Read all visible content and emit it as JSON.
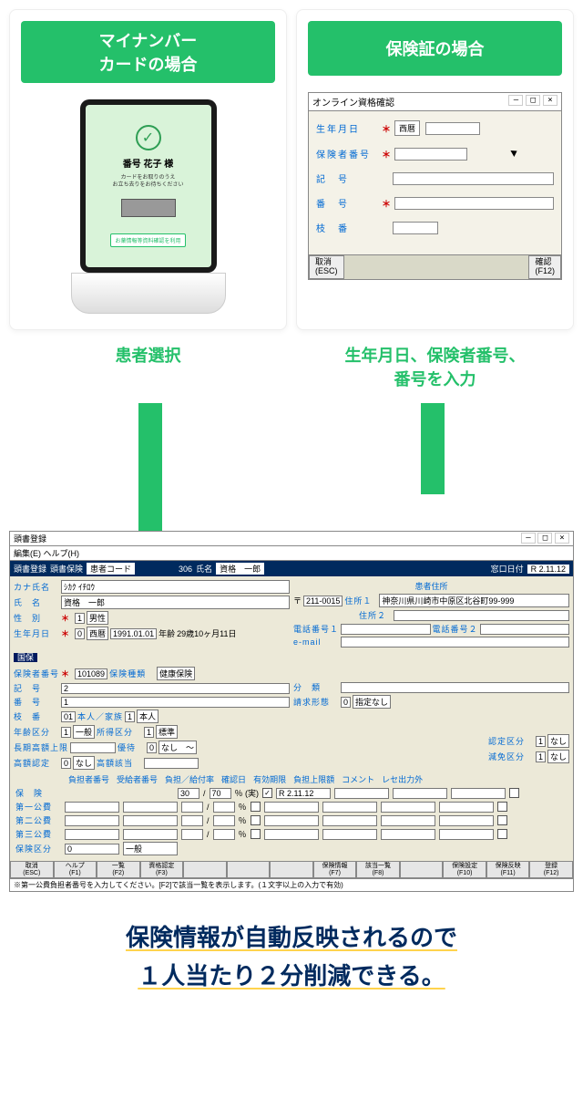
{
  "cards": {
    "left_title": "マイナンバー\nカードの場合",
    "right_title": "保険証の場合"
  },
  "kiosk": {
    "name": "番号 花子 様",
    "hint": "カードをお取りのうえ\nお立ち去りをお待ちください",
    "button": "お薬情報等資料確認を利用"
  },
  "dlg": {
    "title": "オンライン資格確認",
    "rows": {
      "birth": "生年月日",
      "birth_combo": "西暦",
      "insurer": "保険者番号",
      "symbol": "記　号",
      "number": "番　号",
      "branch": "枝　番"
    },
    "foot": {
      "cancel": "取消\n(ESC)",
      "ok": "確認\n(F12)"
    }
  },
  "captions": {
    "left": "患者選択",
    "right": "生年月日、保険者番号、\n番号を入力"
  },
  "reg": {
    "wintitle": "頭書登録",
    "menu": "編集(E) ヘルプ(H)",
    "top": {
      "header1": "頭書登録",
      "header2": "頭書保険",
      "pcode_lab": "患者コード",
      "code": "306",
      "name_lab": "氏名",
      "name_val": "資格　一郎",
      "date_lab": "窓口日付",
      "date_val": "R 2.11.12"
    },
    "left": {
      "kana_lab": "カナ氏名",
      "kana_val": "ｼｶｸ ｲﾁﾛｳ",
      "name_lab": "氏　名",
      "name_val": "資格　一郎",
      "sex_lab": "性　別",
      "sex_code": "1",
      "sex_val": "男性",
      "birth_lab": "生年月日",
      "birth_code": "0",
      "birth_era": "西暦",
      "birth_val": "1991.01.01",
      "age_lab": "年齢",
      "age_val": "29歳10ヶ月11日"
    },
    "right": {
      "addr_h": "患者住所",
      "zip": "211-0015",
      "addr1_lab": "住所１",
      "addr1": "神奈川県川崎市中原区北谷町99-999",
      "addr2_lab": "住所２",
      "tel1_lab": "電話番号１",
      "tel2_lab": "電話番号２",
      "email_lab": "e-mail"
    },
    "ins": {
      "tag": "国保",
      "insurer_lab": "保険者番号",
      "insurer": "101089",
      "kind_lab": "保険種類",
      "kind": "健康保険",
      "symbol_lab": "記　号",
      "symbol": "2",
      "number_lab": "番　号",
      "number": "1",
      "branch_lab": "枝　番",
      "branch": "01",
      "rel_lab": "本人／家族",
      "rel_code": "1",
      "rel": "本人",
      "agecls_lab": "年齢区分",
      "agecls_code": "1",
      "agecls": "一般",
      "inccls_lab": "所得区分",
      "inccls_code": "1",
      "inccls": "標準",
      "cap_lab": "長期高額上限",
      "merit_lab": "優待",
      "merit_code": "0",
      "merit_val": "なし　〜",
      "highamt_lab": "高額認定",
      "highamt_code": "0",
      "highamt_val": "なし",
      "highamt2_lab": "高額該当",
      "class_lab": "分　類",
      "billing_lab": "請求形態",
      "billing_code": "0",
      "billing_val": "指定なし",
      "rec_lab": "認定区分",
      "rec_code": "1",
      "rec_val": "なし",
      "red_lab": "減免区分",
      "red_code": "1",
      "red_val": "なし"
    },
    "hdr": [
      "負担者番号",
      "受給者番号",
      "負担／給付率",
      "確認日",
      "有効期限",
      "負担上限額",
      "コメント",
      "レセ出力外"
    ],
    "rows_lab": [
      "保　険",
      "第一公費",
      "第二公費",
      "第三公費",
      "保険区分"
    ],
    "r0": {
      "rate1": "30",
      "rate2": "70",
      "unit": "％ (実)",
      "chk": "✓",
      "confirm": "R 2.11.12"
    },
    "r4": {
      "c": "0",
      "v": "一般"
    },
    "fns": [
      "取消\n(ESC)",
      "ヘルプ\n(F1)",
      "一覧\n(F2)",
      "資格認定\n(F3)",
      "",
      "",
      "",
      "保険情報\n(F7)",
      "該当一覧\n(F8)",
      "",
      "保険設定\n(F10)",
      "保険反映\n(F11)",
      "登録\n(F12)"
    ],
    "status": "※第一公費負担者番号を入力してください。[F2]で該当一覧を表示します。(１文字以上の入力で有効)"
  },
  "conclusion": {
    "l1": "保険情報が自動反映されるので",
    "l2": "１人当たり２分削減できる。"
  }
}
